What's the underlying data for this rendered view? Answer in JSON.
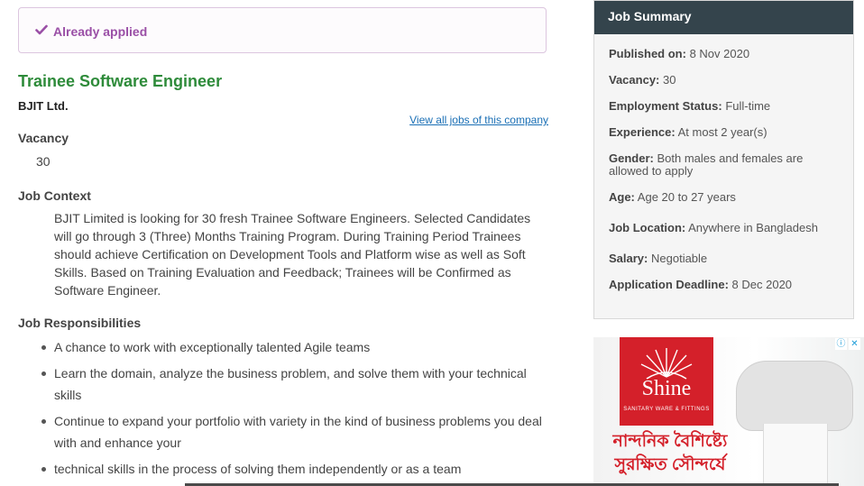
{
  "status": {
    "applied_label": "Already applied"
  },
  "job": {
    "title": "Trainee Software Engineer",
    "company": "BJIT Ltd.",
    "view_all_link": "View all jobs of this company",
    "vacancy_heading": "Vacancy",
    "vacancy_value": "30",
    "context_heading": "Job Context",
    "context_text": "BJIT Limited is looking for 30 fresh Trainee Software Engineers. Selected Candidates will go through 3 (Three) Months Training Program. During Training Period Trainees should achieve Certification on Development Tools and Platform wise as well as Soft Skills. Based on Training Evaluation and Feedback; Trainees will be Confirmed as Software Engineer.",
    "responsibilities_heading": "Job Responsibilities",
    "responsibilities": [
      "A chance to work with exceptionally talented Agile teams",
      "Learn the domain, analyze the business problem, and solve them with your technical skills",
      "Continue to expand your portfolio with variety in the kind of business problems you deal with and enhance your",
      "technical skills in the process of solving them independently or as a team"
    ]
  },
  "summary": {
    "title": "Job Summary",
    "rows": [
      {
        "label": "Published on:",
        "value": "8 Nov 2020"
      },
      {
        "label": "Vacancy:",
        "value": "30"
      },
      {
        "label": "Employment Status:",
        "value": "Full-time"
      },
      {
        "label": "Experience:",
        "value": "At most 2 year(s)"
      },
      {
        "label": "Gender:",
        "value": "Both males and females are allowed to apply"
      },
      {
        "label": "Age:",
        "value": "Age 20 to 27 years"
      },
      {
        "label": "Job Location:",
        "value": "Anywhere in Bangladesh"
      },
      {
        "label": "Salary:",
        "value": "Negotiable"
      },
      {
        "label": "Application Deadline:",
        "value": "8 Dec 2020"
      }
    ]
  },
  "ad": {
    "brand": "Shine",
    "brand_sub": "SANITARY WARE & FITTINGS",
    "tagline_line1": "নান্দনিক বৈশিষ্ট্যে",
    "tagline_line2": "সুরক্ষিত সৌন্দর্যে",
    "info_icon": "info-icon",
    "close_icon": "close-icon"
  },
  "colors": {
    "title_green": "#2e8b3a",
    "applied_purple": "#9a4fa6",
    "summary_header": "#34444c",
    "link_blue": "#1a6fb5",
    "brand_red": "#d4202a"
  }
}
